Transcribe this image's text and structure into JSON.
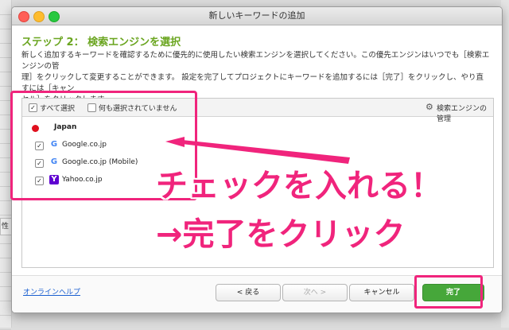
{
  "background": {
    "tab_label": "性"
  },
  "window": {
    "title": "新しいキーワードの追加"
  },
  "step": {
    "title": "ステップ 2： 検索エンジンを選択"
  },
  "description": {
    "line1": "新しく追加するキーワードを確認するために優先的に使用したい検索エンジンを選択してください。この優先エンジンはいつでも［検索エンジンの管",
    "line2": "理］をクリックして変更することができます。 設定を完了してプロジェクトにキーワードを追加するには［完了］をクリックし、やり直すには［キャン",
    "line3": "セル］をクリックします。"
  },
  "toolbar": {
    "select_all": "すべて選択",
    "none_selected": "何も選択されていません",
    "manage_engines": "検索エンジンの管理"
  },
  "group": {
    "label": "Japan"
  },
  "engines": [
    {
      "name": "Google.co.jp",
      "checked": true,
      "icon": "google-icon"
    },
    {
      "name": "Google.co.jp (Mobile)",
      "checked": true,
      "icon": "google-icon"
    },
    {
      "name": "Yahoo.co.jp",
      "checked": true,
      "icon": "yahoo-icon"
    }
  ],
  "footer": {
    "help": "オンラインヘルプ",
    "back": "< 戻る",
    "next": "次へ >",
    "cancel": "キャンセル",
    "finish": "完了"
  },
  "annotations": {
    "line1": "チェックを入れる！",
    "line2": "→完了をクリック",
    "color": "#f0247c"
  },
  "colors": {
    "step_title": "#6aa51f",
    "finish_button": "#46a73a"
  }
}
